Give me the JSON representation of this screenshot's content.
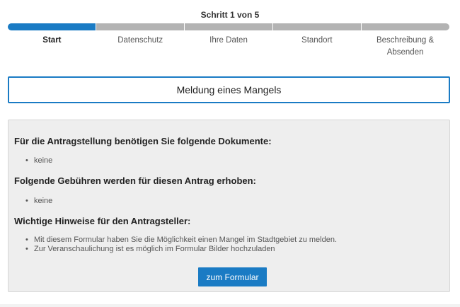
{
  "wizard": {
    "step_counter": "Schritt 1 von 5",
    "steps": [
      {
        "label": "Start",
        "active": true
      },
      {
        "label": "Datenschutz",
        "active": false
      },
      {
        "label": "Ihre Daten",
        "active": false
      },
      {
        "label": "Standort",
        "active": false
      },
      {
        "label": "Beschreibung & Absenden",
        "active": false
      }
    ],
    "colors": {
      "active": "#1a7bc4",
      "inactive": "#b3b3b3"
    }
  },
  "form_title": "Meldung eines Mangels",
  "info": {
    "documents_heading": "Für die Antragstellung benötigen Sie folgende Dokumente:",
    "documents_items": [
      "keine"
    ],
    "fees_heading": "Folgende Gebühren werden für diesen Antrag erhoben:",
    "fees_items": [
      "keine"
    ],
    "notes_heading": "Wichtige Hinweise für den Antragsteller:",
    "notes_items": [
      "Mit diesem Formular haben Sie die Möglichkeit einen Mangel im Stadtgebiet zu melden.",
      "Zur Veranschaulichung ist es möglich im Formular Bilder hochzuladen"
    ],
    "button_label": "zum Formular"
  }
}
